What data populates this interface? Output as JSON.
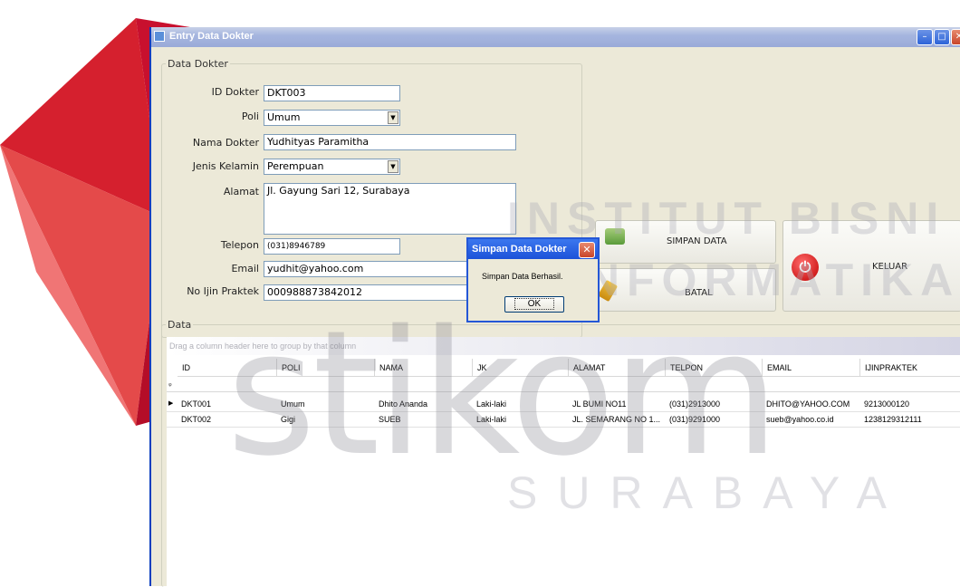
{
  "watermark": {
    "line1": "INSTITUT BISNI",
    "line2": "& INFORMATIKA",
    "logo": "stikom",
    "city": "SURABAYA"
  },
  "window": {
    "title": "Entry Data Dokter",
    "controls": [
      "minimize-icon",
      "maximize-icon",
      "close-icon"
    ]
  },
  "form": {
    "group_label": "Data Dokter",
    "id_label": "ID Dokter",
    "id_value": "DKT003",
    "poli_label": "Poli",
    "poli_value": "Umum",
    "nama_label": "Nama Dokter",
    "nama_value": "Yudhityas Paramitha",
    "jk_label": "Jenis Kelamin",
    "jk_value": "Perempuan",
    "alamat_label": "Alamat",
    "alamat_value": "Jl. Gayung Sari 12, Surabaya",
    "telepon_label": "Telepon",
    "telepon_value": "(031)8946789",
    "email_label": "Email",
    "email_value": "yudhit@yahoo.com",
    "ijin_label": "No Ijin Praktek",
    "ijin_value": "000988873842012"
  },
  "buttons": {
    "simpan": "SIMPAN DATA",
    "batal": "BATAL",
    "keluar": "KELUAR"
  },
  "grid": {
    "group_label": "Data",
    "group_hint": "Drag a column header here to group by that column",
    "columns": [
      "ID",
      "POLI",
      "NAMA",
      "JK",
      "ALAMAT",
      "TELPON",
      "EMAIL",
      "IJINPRAKTEK"
    ],
    "rows": [
      [
        "DKT001",
        "Umum",
        "Dhito Ananda",
        "Laki-laki",
        "JL BUMI NO11",
        "(031)2913000",
        "DHITO@YAHOO.COM",
        "9213000120"
      ],
      [
        "DKT002",
        "Gigi",
        "SUEB",
        "Laki-laki",
        "JL. SEMARANG NO 1...",
        "(031)9291000",
        "sueb@yahoo.co.id",
        "1238129312111"
      ]
    ]
  },
  "dialog": {
    "title": "Simpan Data Dokter",
    "message": "Simpan Data Berhasil.",
    "ok": "OK"
  },
  "colors": {
    "accent": "#2457d6",
    "watermark_red": "#c8102e"
  }
}
